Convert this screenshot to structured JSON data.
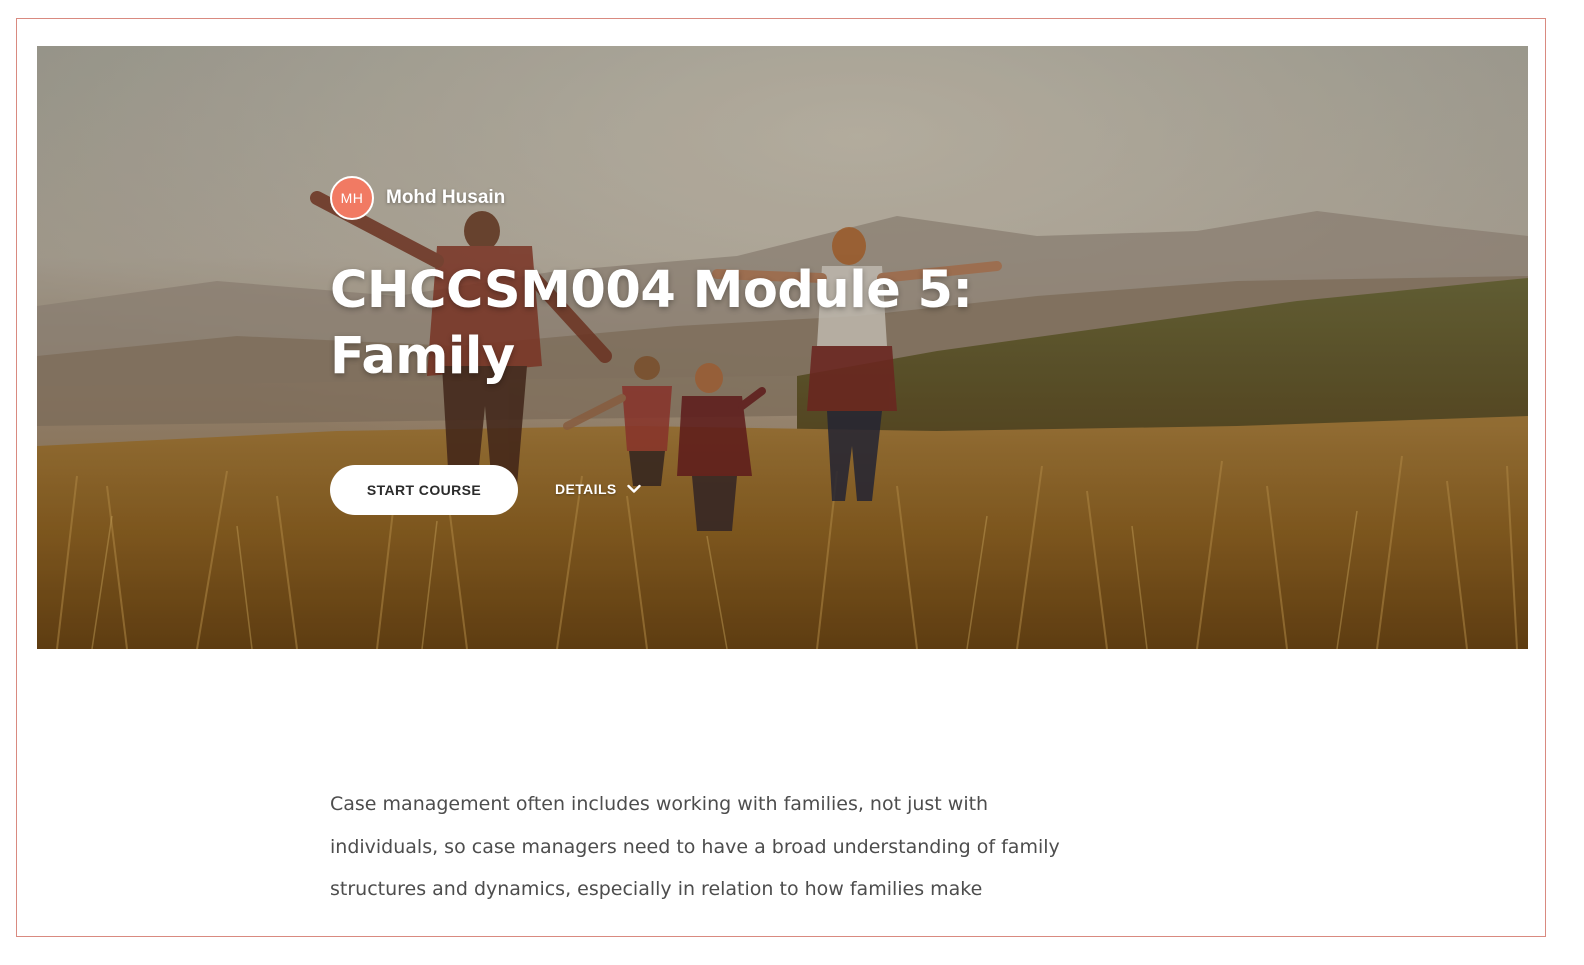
{
  "author": {
    "initials": "MH",
    "name": "Mohd Husain"
  },
  "course": {
    "title": "CHCCSM004 Module 5: Family",
    "start_label": "START COURSE",
    "details_label": "DETAILS"
  },
  "description": "Case management often includes working with families, not just with individuals, so case managers need to have a broad understanding of family structures and dynamics, especially in relation to how families make",
  "icons": {
    "details_toggle": "chevron-down-icon"
  },
  "colors": {
    "avatar_bg": "#f17a63",
    "frame_border": "#d98a80",
    "button_bg": "#ffffff",
    "body_text": "#4d4d4d"
  }
}
